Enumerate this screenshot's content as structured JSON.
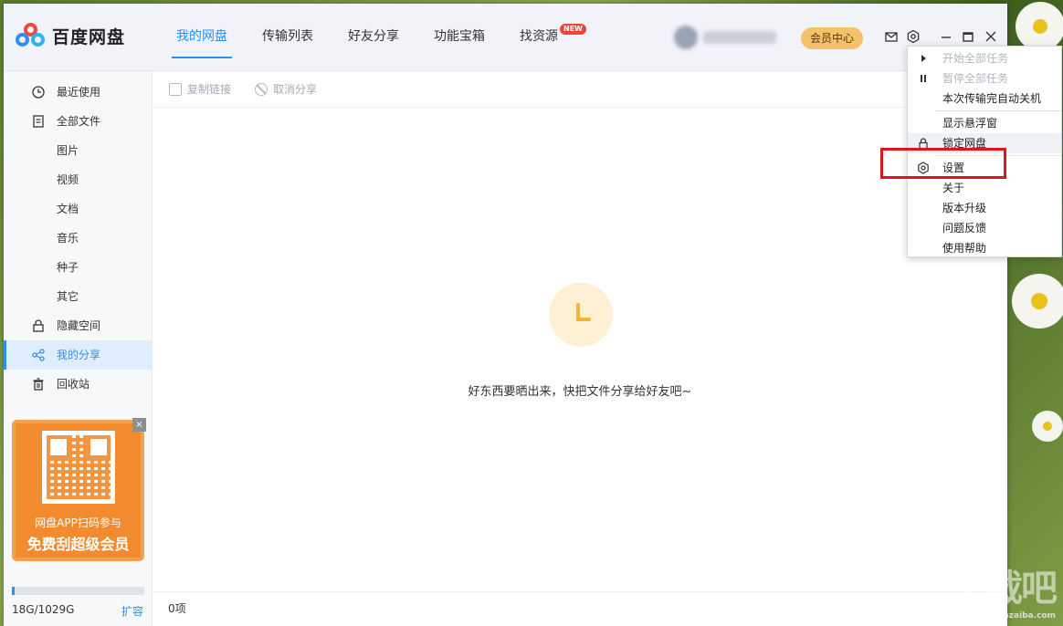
{
  "header": {
    "logo_text": "百度网盘",
    "tabs": [
      {
        "label": "我的网盘",
        "active": true
      },
      {
        "label": "传输列表",
        "active": false
      },
      {
        "label": "好友分享",
        "active": false
      },
      {
        "label": "功能宝箱",
        "active": false
      },
      {
        "label": "找资源",
        "active": false,
        "badge": "NEW"
      }
    ],
    "vip_label": "会员中心",
    "icons": [
      "mail-icon",
      "gear-icon",
      "minimize-icon",
      "maximize-icon",
      "close-icon"
    ]
  },
  "sidebar": {
    "items": [
      {
        "label": "最近使用",
        "icon": "clock-icon",
        "sub": false
      },
      {
        "label": "全部文件",
        "icon": "document-icon",
        "sub": false
      },
      {
        "label": "图片",
        "sub": true
      },
      {
        "label": "视频",
        "sub": true
      },
      {
        "label": "文档",
        "sub": true
      },
      {
        "label": "音乐",
        "sub": true
      },
      {
        "label": "种子",
        "sub": true
      },
      {
        "label": "其它",
        "sub": true
      },
      {
        "label": "隐藏空间",
        "icon": "lock-icon",
        "sub": false
      },
      {
        "label": "我的分享",
        "icon": "share-icon",
        "sub": false,
        "active": true
      },
      {
        "label": "回收站",
        "icon": "trash-icon",
        "sub": false
      }
    ],
    "promo": {
      "line1": "网盘APP扫码参与",
      "line2": "免费刮超级会员",
      "close": "×"
    },
    "quota": {
      "text": "18G/1029G",
      "expand": "扩容",
      "used_fraction": 0.0175
    }
  },
  "toolbar": {
    "copy_link": "复制链接",
    "cancel_share": "取消分享"
  },
  "main": {
    "empty_message": "好东西要晒出来，快把文件分享给好友吧~",
    "status": "0项"
  },
  "menu": {
    "groups": [
      [
        {
          "label": "开始全部任务",
          "icon": "▶",
          "disabled": true
        },
        {
          "label": "暂停全部任务",
          "icon": "❚❚",
          "disabled": true
        },
        {
          "label": "本次传输完自动关机",
          "icon": "",
          "disabled": false
        }
      ],
      [
        {
          "label": "显示悬浮窗",
          "icon": "",
          "disabled": false
        },
        {
          "label": "锁定网盘",
          "icon": "lock",
          "disabled": false,
          "hover": true
        }
      ],
      [
        {
          "label": "设置",
          "icon": "gear",
          "disabled": false,
          "highlighted": true
        },
        {
          "label": "关于",
          "icon": "",
          "disabled": false
        },
        {
          "label": "版本升级",
          "icon": "",
          "disabled": false
        },
        {
          "label": "问题反馈",
          "icon": "",
          "disabled": false
        },
        {
          "label": "使用帮助",
          "icon": "",
          "disabled": false
        }
      ]
    ]
  },
  "watermark": {
    "text": "下载吧",
    "sub": "www.xiazaiba.com"
  },
  "colors": {
    "accent": "#2f8ef5",
    "vip": "#f3c26a",
    "promo": "#f28a2e",
    "highlight": "#e0141b"
  }
}
